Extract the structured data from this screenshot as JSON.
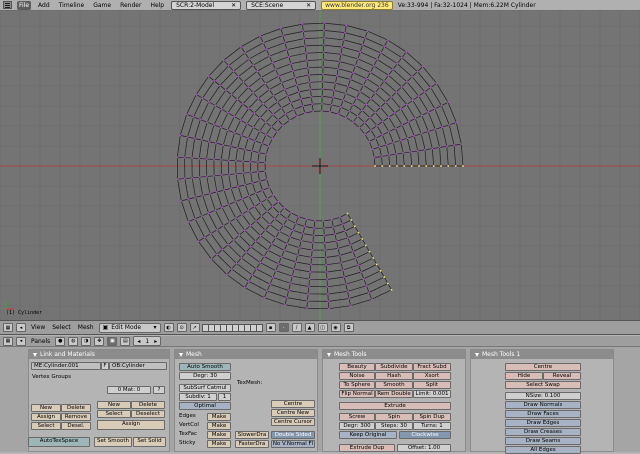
{
  "topbar": {
    "menus": [
      "File",
      "Add",
      "Timeline",
      "Game",
      "Render",
      "Help"
    ],
    "screen_field": "SCR:2-Model",
    "scene_field": "SCE:Scene",
    "url": "www.blender.org 236",
    "stats": "Ve:33-994 | Fa:32-1024 | Mem:6.22M Cylinder"
  },
  "viewport": {
    "object_label": "(1) Cylinder",
    "wire_color": "#1e1e1e",
    "vert_color": "#b64bd4",
    "bg_color": "#747474",
    "axis_x_color": "#a64a4a",
    "axis_y_color": "#4aa64a"
  },
  "header3d": {
    "view": "View",
    "select": "Select",
    "mesh": "Mesh",
    "mode": "Edit Mode"
  },
  "buttons_header": {
    "panels": "Panels",
    "frame": "1"
  },
  "link_materials": {
    "title": "Link and Materials",
    "mesh_name": "ME:Cylinder.001",
    "f_label": "F",
    "object_name": "OB:Cylinder",
    "vertex_groups": "Vertex Groups",
    "mat_field": "0 Mat: 0",
    "question": "?",
    "new1": "New",
    "delete1": "Delete",
    "assign1": "Assign",
    "remove1": "Remove",
    "select1": "Select",
    "deselect1": "Desel.",
    "new2": "New",
    "delete2": "Delete",
    "select2": "Select",
    "deselect2": "Deselect",
    "assign2": "Assign",
    "autotexspace": "AutoTexSpace",
    "set_smooth": "Set Smooth",
    "set_solid": "Set Solid"
  },
  "mesh_panel": {
    "title": "Mesh",
    "auto_smooth": "Auto Smooth",
    "degr": "Degr: 30",
    "subsurf": "SubSurf Catmul",
    "subdiv": "Subdiv: 1",
    "subdiv2": "1",
    "optimal": "Optimal",
    "texmesh": "TexMesh:",
    "edges": "Edges",
    "vertcol": "VertCol",
    "texface": "TexFac",
    "sticky": "Sticky",
    "make": "Make",
    "centre": "Centre",
    "centre_new": "Centre New",
    "centre_cursor": "Centre Cursor",
    "slower": "SlowerDra",
    "faster": "FasterDra",
    "double_sided": "Double Sided",
    "no_vnormal": "No V.Normal Fl"
  },
  "mesh_tools": {
    "title": "Mesh Tools",
    "beauty": "Beauty",
    "subdivide": "Subdivide",
    "fract_subd": "Fract Subd",
    "noise": "Noise",
    "hash": "Hash",
    "xsort": "Xsort",
    "to_sphere": "To Sphere",
    "smooth": "Smooth",
    "split": "Split",
    "flip_normal": "Flip Normal",
    "rem_double": "Rem Double",
    "limit": "Limit: 0.001",
    "extrude": "Extrude",
    "screw": "Screw",
    "spin": "Spin",
    "spin_dup": "Spin Dup",
    "degr": "Degr: 300",
    "steps": "Steps: 30",
    "turns": "Turns: 1",
    "keep_original": "Keep Original",
    "clockwise": "Clockwise",
    "extrude_dup": "Extrude Dup",
    "offset": "Offset: 1.00"
  },
  "mesh_tools1": {
    "title": "Mesh Tools 1",
    "centre": "Centre",
    "hide": "Hide",
    "reveal": "Reveal",
    "select_swap": "Select Swap",
    "nsize": "NSize: 0.100",
    "draw_normals": "Draw Normals",
    "draw_faces": "Draw Faces",
    "draw_edges": "Draw Edges",
    "draw_creases": "Draw Creases",
    "draw_seams": "Draw Seams",
    "all_edges": "All Edges"
  }
}
